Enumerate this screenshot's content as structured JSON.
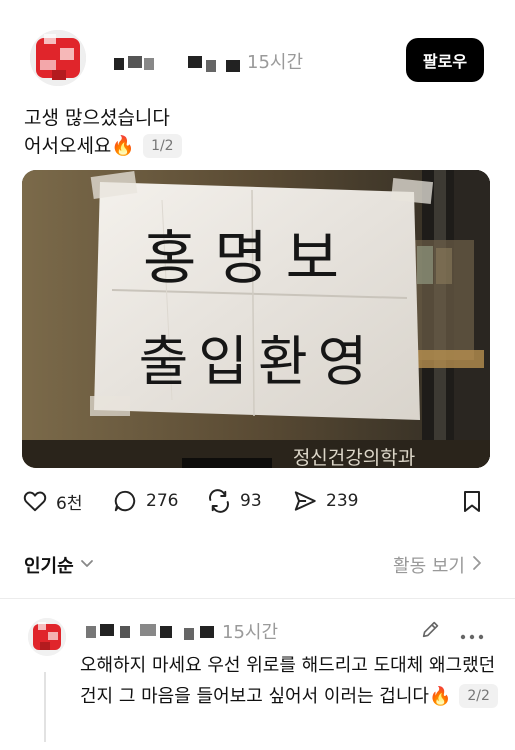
{
  "post": {
    "time": "15시간",
    "follow_label": "팔로우",
    "line1": "고생 많으셨습니다",
    "line2": "어서오세요🔥",
    "page": "1/2",
    "image": {
      "sign_line1": "홍명보",
      "sign_line2": "출입환영",
      "door_sign": "정신건강의학과"
    },
    "actions": {
      "likes": "6천",
      "comments": "276",
      "reposts": "93",
      "shares": "239"
    }
  },
  "sort": {
    "label": "인기순",
    "activity_label": "활동 보기"
  },
  "reply": {
    "time": "15시간",
    "text": "오해하지 마세요 우선 위로를 해드리고 도대체 왜그랬던 건지 그 마음을 들어보고 싶어서 이러는 겁니다🔥",
    "page": "2/2"
  },
  "colors": {
    "follow_bg": "#000000",
    "muted_text": "#999999",
    "avatar_red": "#e0252b"
  },
  "icons": [
    "heart-icon",
    "comment-icon",
    "repost-icon",
    "share-icon",
    "bookmark-icon",
    "chevron-down-icon",
    "chevron-right-icon",
    "edit-icon",
    "more-icon"
  ]
}
